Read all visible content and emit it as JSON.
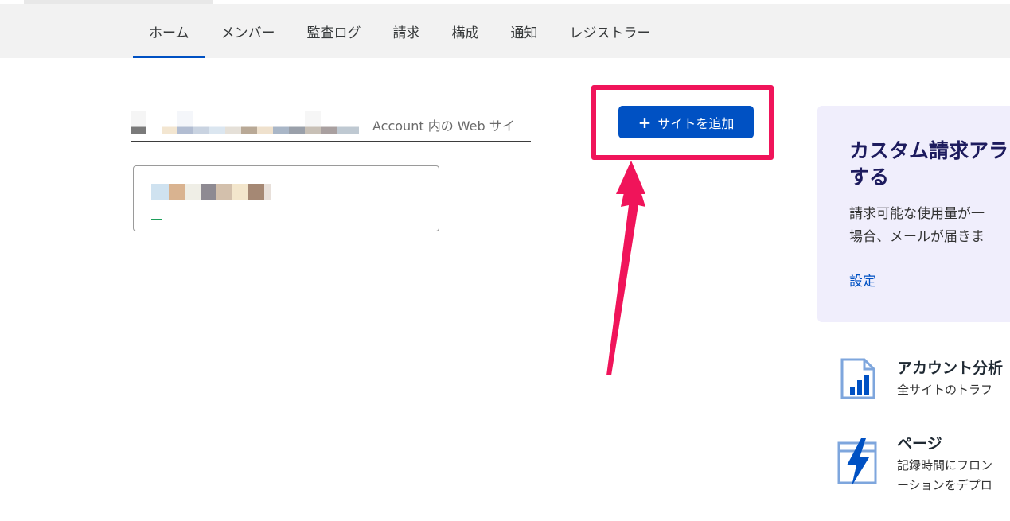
{
  "nav": {
    "tabs": [
      {
        "label": "ホーム",
        "active": true
      },
      {
        "label": "メンバー"
      },
      {
        "label": "監査ログ"
      },
      {
        "label": "請求"
      },
      {
        "label": "構成"
      },
      {
        "label": "通知"
      },
      {
        "label": "レジストラー"
      }
    ]
  },
  "search": {
    "placeholder": "Account 内の Web サイ"
  },
  "toolbar": {
    "add_site_label": "サイトを追加"
  },
  "promo": {
    "title": "カスタム請求アラ\nする",
    "body": "請求可能な使用量が一\n場合、メールが届きま",
    "link_label": "設定"
  },
  "features": [
    {
      "title": "アカウント分析",
      "desc": "全サイトのトラフ",
      "icon": "analytics-icon"
    },
    {
      "title": "ページ",
      "desc": "記録時間にフロン\nーションをデプロ",
      "icon": "pages-lightning-icon"
    }
  ],
  "colors": {
    "accent": "#0051c3",
    "highlight": "#f0145a",
    "promo_bg": "#f0eefc"
  }
}
